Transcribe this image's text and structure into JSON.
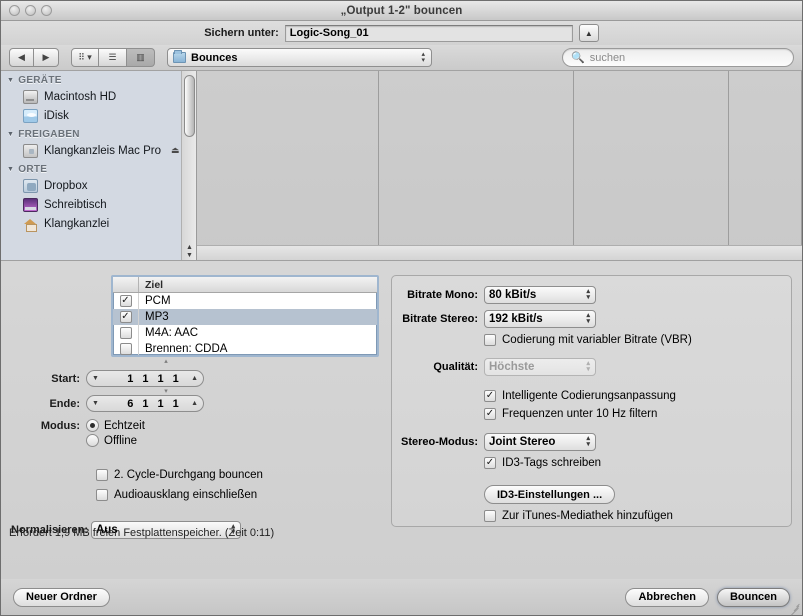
{
  "window": {
    "title": "„Output 1-2\" bouncen"
  },
  "save_row": {
    "label": "Sichern unter:",
    "filename": "Logic-Song_01",
    "disclosure_icon": "triangle-up-icon"
  },
  "toolbar": {
    "back_icon": "chevron-left-icon",
    "forward_icon": "chevron-right-icon",
    "icon_view_icon": "grid-view-icon",
    "list_view_icon": "list-view-icon",
    "column_view_icon": "column-view-icon",
    "path_label": "Bounces",
    "path_icon": "folder-icon",
    "search_placeholder": "suchen",
    "search_value": "",
    "search_icon": "search-icon"
  },
  "sidebar": {
    "groups": [
      {
        "header": "GERÄTE",
        "items": [
          {
            "label": "Macintosh HD",
            "icon": "hard-disk-icon",
            "eject": false
          },
          {
            "label": "iDisk",
            "icon": "idisk-icon",
            "eject": false
          }
        ]
      },
      {
        "header": "FREIGABEN",
        "items": [
          {
            "label": "Klangkanzleis Mac Pro",
            "icon": "server-icon",
            "eject": true,
            "eject_icon": "eject-icon"
          }
        ]
      },
      {
        "header": "ORTE",
        "items": [
          {
            "label": "Dropbox",
            "icon": "dropbox-folder-icon",
            "eject": false
          },
          {
            "label": "Schreibtisch",
            "icon": "desktop-icon",
            "eject": false
          },
          {
            "label": "Klangkanzlei",
            "icon": "home-icon",
            "eject": false
          }
        ]
      }
    ]
  },
  "formats": {
    "column_header": "Ziel",
    "rows": [
      {
        "label": "PCM",
        "checked": true,
        "selected": false,
        "check_icon": "checkmark-icon"
      },
      {
        "label": "MP3",
        "checked": true,
        "selected": true,
        "check_icon": "checkmark-icon"
      },
      {
        "label": "M4A: AAC",
        "checked": false,
        "selected": false,
        "check_icon": "checkmark-icon"
      },
      {
        "label": "Brennen: CDDA",
        "checked": false,
        "selected": false,
        "check_icon": "checkmark-icon"
      }
    ]
  },
  "range": {
    "start_label": "Start:",
    "start_values": [
      "1",
      "1",
      "1",
      "1"
    ],
    "end_label": "Ende:",
    "end_values": [
      "6",
      "1",
      "1",
      "1"
    ],
    "stepper_down_icon": "triangle-down-icon",
    "stepper_up_icon": "triangle-up-icon"
  },
  "mode": {
    "label": "Modus:",
    "options": [
      {
        "label": "Echtzeit",
        "selected": true
      },
      {
        "label": "Offline",
        "selected": false
      }
    ]
  },
  "left_checkboxes": [
    {
      "label": "2. Cycle-Durchgang bouncen",
      "checked": false
    },
    {
      "label": "Audioausklang einschließen",
      "checked": false
    }
  ],
  "normalize": {
    "label": "Normalisieren:",
    "value": "Aus"
  },
  "mp3": {
    "bitrate_mono_label": "Bitrate Mono:",
    "bitrate_mono_value": "80 kBit/s",
    "bitrate_stereo_label": "Bitrate Stereo:",
    "bitrate_stereo_value": "192 kBit/s",
    "vbr_label": "Codierung mit variabler Bitrate (VBR)",
    "vbr_checked": false,
    "quality_label": "Qualität:",
    "quality_value": "Höchste",
    "quality_disabled": true,
    "smart_encoding_label": "Intelligente Codierungsanpassung",
    "smart_encoding_checked": true,
    "filter_label": "Frequenzen unter 10 Hz filtern",
    "filter_checked": true,
    "stereo_mode_label": "Stereo-Modus:",
    "stereo_mode_value": "Joint Stereo",
    "id3_label": "ID3-Tags schreiben",
    "id3_checked": true,
    "id3_settings_button": "ID3-Einstellungen ...",
    "itunes_label": "Zur iTunes-Mediathek hinzufügen",
    "itunes_checked": false
  },
  "status": {
    "text": "Erfordert 1,9 MB freien Festplattenspeicher.  (Zeit 0:11)"
  },
  "bottom": {
    "new_folder": "Neuer Ordner",
    "cancel": "Abbrechen",
    "bounce": "Bouncen"
  },
  "colors": {
    "selection_row": "#b6c2d0",
    "focus_border": "#9fb6cf",
    "sidebar_bg": "#d3d9e2"
  }
}
